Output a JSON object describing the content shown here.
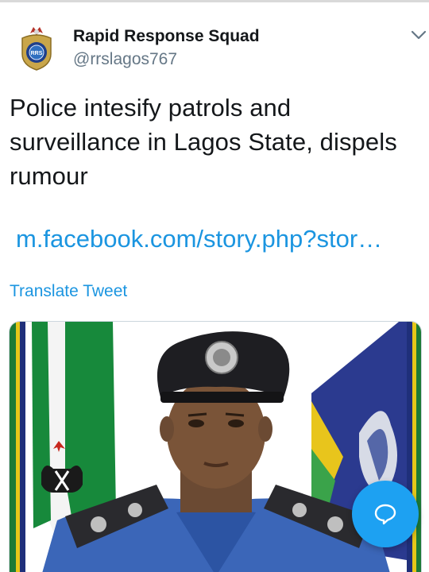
{
  "tweet": {
    "display_name": "Rapid Response Squad",
    "handle": "@rrslagos767",
    "avatar_icon": "police-badge-icon",
    "avatar_badge_text": "RRS",
    "menu_icon": "chevron-down-icon",
    "text": "Police intesify patrols and surveillance in Lagos State, dispels rumour",
    "link_text": "m.facebook.com/story.php?stor…",
    "translate_label": "Translate Tweet",
    "media": {
      "description_icon": "police-officer-photo",
      "left_flag_colors": [
        "#1a8a3a",
        "#ffffff"
      ],
      "right_flag_color": "#2b3a8f"
    }
  },
  "fab": {
    "icon": "reply-bubble-icon",
    "color": "#1da1f2"
  },
  "colors": {
    "link": "#1b95e0",
    "secondary_text": "#657786",
    "primary_text": "#14171a"
  }
}
